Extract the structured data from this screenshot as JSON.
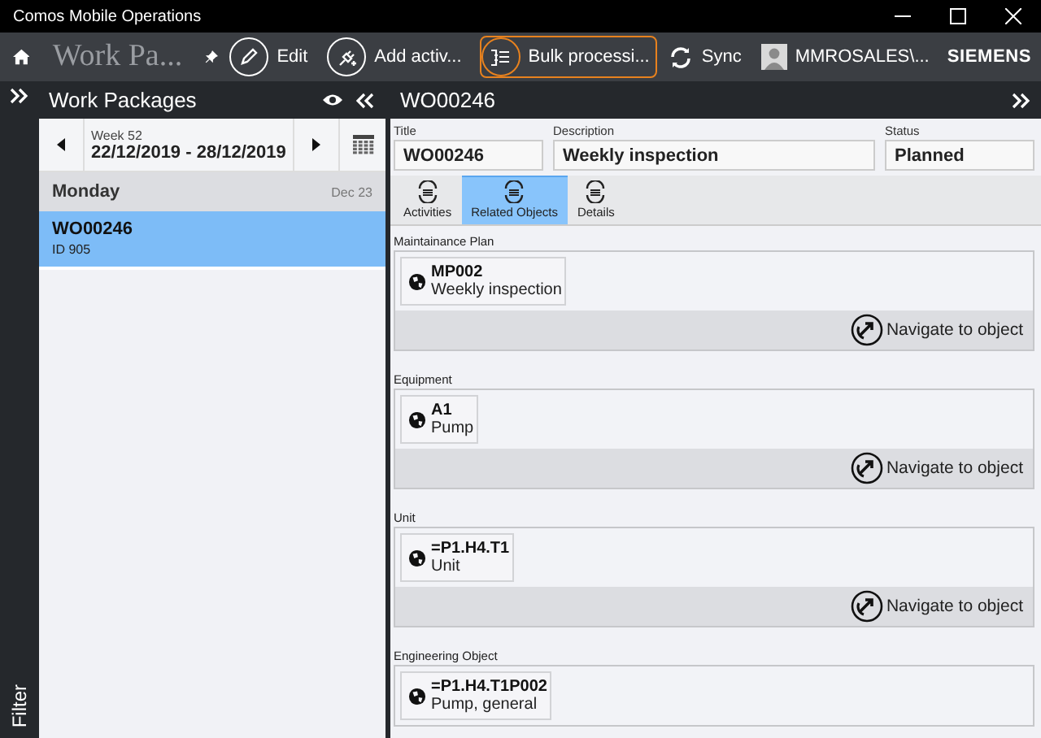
{
  "window": {
    "title": "Comos Mobile Operations"
  },
  "toolbar": {
    "page_title": "Work Pa...",
    "actions": [
      {
        "kind": "circle",
        "label": "Edit",
        "focused": false
      },
      {
        "kind": "circle",
        "label": "Add activ...",
        "focused": false
      },
      {
        "kind": "circle",
        "label": "Bulk processi...",
        "focused": true
      },
      {
        "kind": "plain",
        "label": "Sync",
        "focused": false
      },
      {
        "kind": "user",
        "label": "MMROSALES\\...",
        "focused": false
      }
    ],
    "brand": "SIEMENS"
  },
  "side_strip": {
    "label": "Filter"
  },
  "work_packages": {
    "title": "Work Packages",
    "week_label": "Week 52",
    "week_range": "22/12/2019 - 28/12/2019",
    "groups": [
      {
        "day": "Monday",
        "date": "Dec 23",
        "items": [
          {
            "title": "WO00246",
            "subtitle": "ID 905",
            "selected": true
          }
        ]
      }
    ]
  },
  "detail": {
    "title": "WO00246",
    "fields": [
      {
        "label": "Title",
        "value": "WO00246"
      },
      {
        "label": "Description",
        "value": "Weekly inspection"
      },
      {
        "label": "Status",
        "value": "Planned"
      }
    ],
    "tabs": [
      {
        "label": "Activities",
        "selected": false
      },
      {
        "label": "Related Objects",
        "selected": true
      },
      {
        "label": "Details",
        "selected": false
      }
    ],
    "sections": [
      {
        "label": "Maintainance Plan",
        "object_id": "MP002",
        "object_name": "Weekly inspection",
        "action": "Navigate to object"
      },
      {
        "label": "Equipment",
        "object_id": "A1",
        "object_name": "Pump",
        "action": "Navigate to object"
      },
      {
        "label": "Unit",
        "object_id": "=P1.H4.T1",
        "object_name": "Unit",
        "action": "Navigate to object"
      },
      {
        "label": "Engineering Object",
        "object_id": "=P1.H4.T1P002",
        "object_name": "Pump, general"
      }
    ]
  }
}
